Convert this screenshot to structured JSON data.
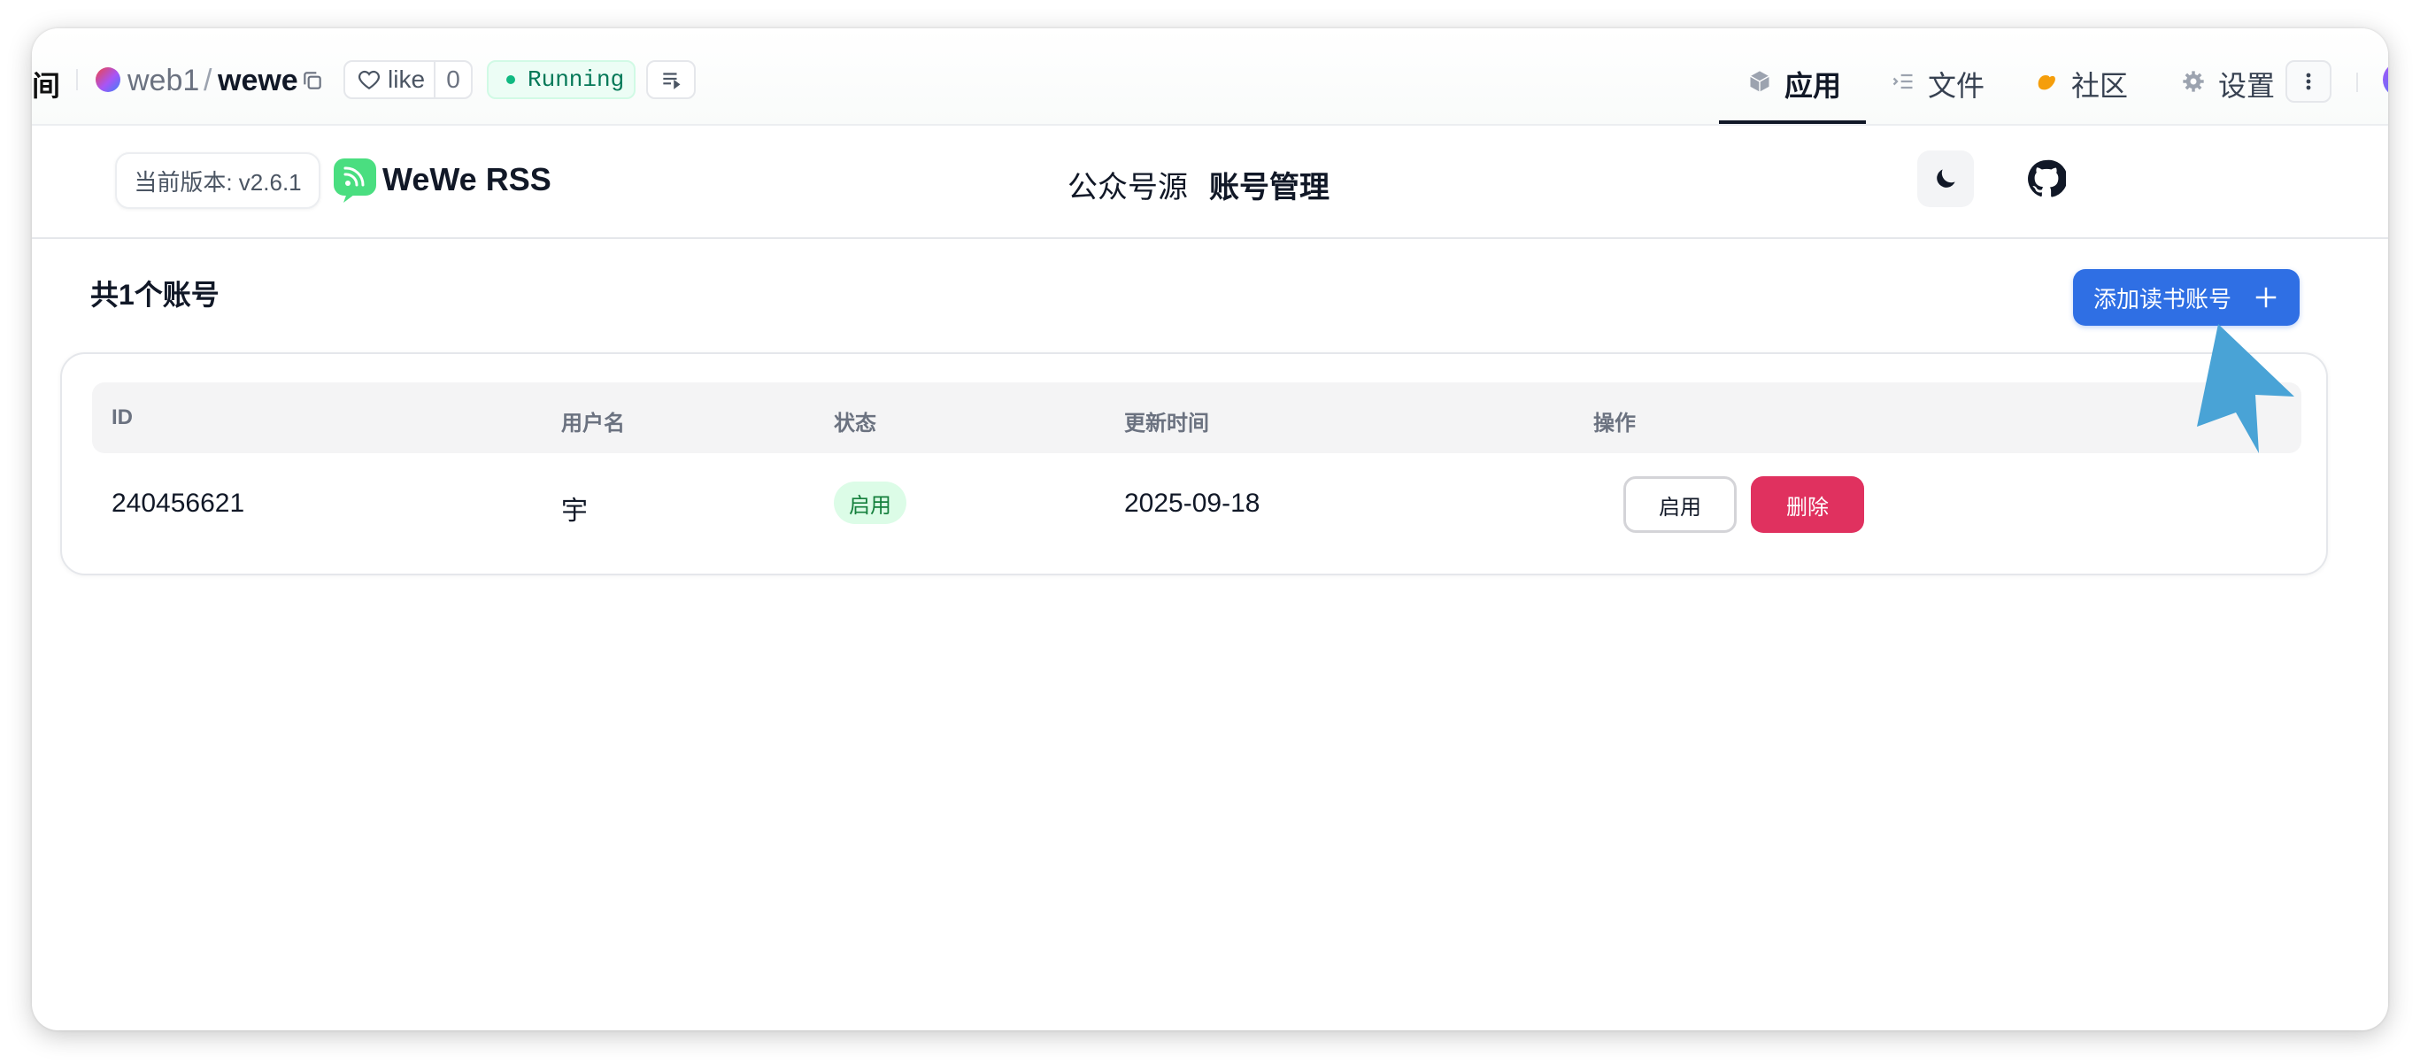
{
  "hf_bar": {
    "cut_title": "间",
    "owner": "web1",
    "slash": "/",
    "space_name": "wewe",
    "like_label": "like",
    "like_count": "0",
    "status": "Running",
    "tabs": [
      {
        "label": "应用",
        "icon": "cube-icon",
        "active": true
      },
      {
        "label": "文件",
        "icon": "files-icon",
        "active": false
      },
      {
        "label": "社区",
        "icon": "community-icon",
        "active": false
      },
      {
        "label": "设置",
        "icon": "gear-icon",
        "active": false
      }
    ]
  },
  "app_header": {
    "version": "当前版本: v2.6.1",
    "brand": "WeWe RSS",
    "nav": [
      {
        "label": "公众号源",
        "active": false
      },
      {
        "label": "账号管理",
        "active": true
      }
    ]
  },
  "main": {
    "count_title": "共1个账号",
    "add_button": "添加读书账号",
    "table": {
      "headers": [
        "ID",
        "用户名",
        "状态",
        "更新时间",
        "操作"
      ],
      "rows": [
        {
          "id": "240456621",
          "username": "宇",
          "status": "启用",
          "updated": "2025-09-18",
          "actions": [
            "启用",
            "删除"
          ]
        }
      ]
    }
  },
  "colors": {
    "primary": "#2f6fe4",
    "danger": "#e0315f",
    "status_bg": "#dcfce7",
    "status_text": "#15803d",
    "brand_logo": "#4ade80",
    "cursor": "#49a3d6"
  }
}
